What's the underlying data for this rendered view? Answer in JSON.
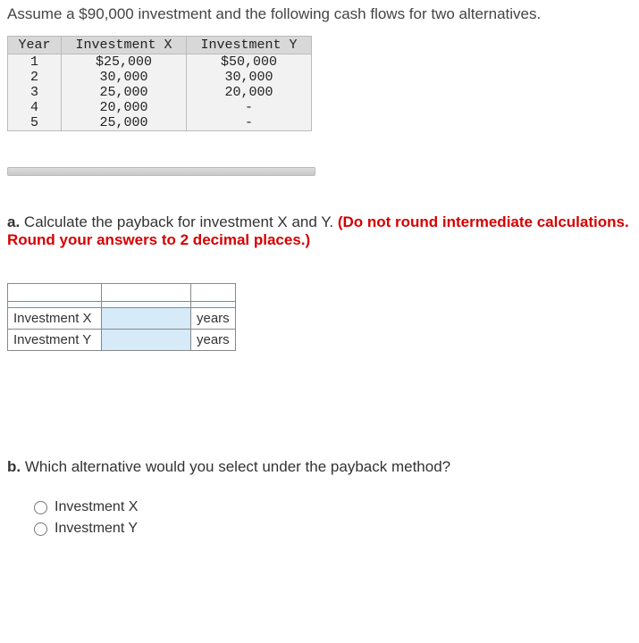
{
  "intro": "Assume a $90,000 investment and the following cash flows for two alternatives.",
  "data_table": {
    "headers": [
      "Year",
      "Investment X",
      "Investment Y"
    ],
    "rows": [
      {
        "year": "1",
        "x": "$25,000",
        "y": "$50,000"
      },
      {
        "year": "2",
        "x": "30,000",
        "y": "30,000"
      },
      {
        "year": "3",
        "x": "25,000",
        "y": "20,000"
      },
      {
        "year": "4",
        "x": "20,000",
        "y": "-"
      },
      {
        "year": "5",
        "x": "25,000",
        "y": "-"
      }
    ]
  },
  "part_a": {
    "label": "a.",
    "text": " Calculate the payback for investment X and Y. ",
    "instruction": "(Do not round intermediate calculations. Round your answers to 2 decimal places.)"
  },
  "answer_table": {
    "rows": [
      {
        "label": "Investment X",
        "unit": "years"
      },
      {
        "label": "Investment Y",
        "unit": "years"
      }
    ]
  },
  "part_b": {
    "label": "b.",
    "text": " Which alternative would you select under the payback method?"
  },
  "options": [
    {
      "label": "Investment X"
    },
    {
      "label": "Investment Y"
    }
  ]
}
